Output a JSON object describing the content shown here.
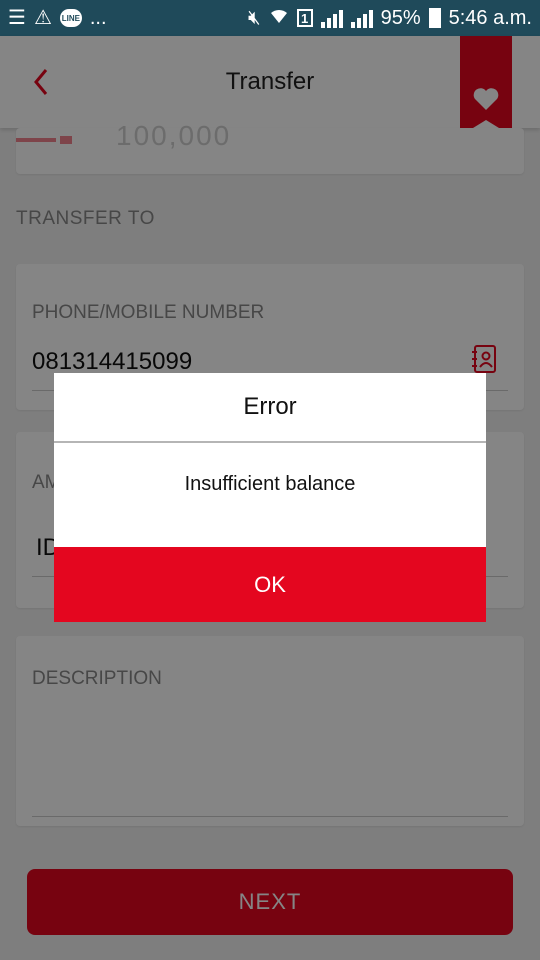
{
  "status_bar": {
    "battery": "95%",
    "time": "5:46 a.m.",
    "sim_slot": "1",
    "line_badge": "LINE",
    "overflow": "..."
  },
  "header": {
    "title": "Transfer"
  },
  "form": {
    "previous_amount_faded": "100,000",
    "transfer_to_label": "TRANSFER TO",
    "phone_label": "PHONE/MOBILE NUMBER",
    "phone_value": "081314415099",
    "amount_label": "AMOUNT",
    "amount_prefix": "IDR",
    "description_label": "DESCRIPTION",
    "next_label": "NEXT"
  },
  "dialog": {
    "title": "Error",
    "message": "Insufficient balance",
    "ok_label": "OK"
  },
  "colors": {
    "accent": "#e4061f",
    "status_bar": "#1f4a5a",
    "ribbon": "#c8102e"
  },
  "icons": [
    "menu-icon",
    "warning-icon",
    "line-icon",
    "mute-icon",
    "wifi-icon",
    "sim-icon",
    "signal-icon",
    "battery-icon",
    "back-icon",
    "heart-icon",
    "contact-book-icon"
  ]
}
